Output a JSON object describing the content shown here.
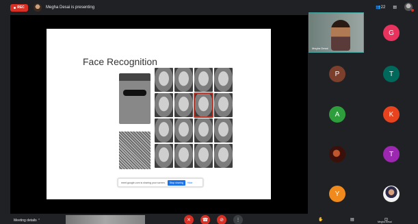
{
  "top": {
    "rec_label": "REC",
    "presenting_text": "Megha Desai is presenting",
    "participants_count": "22"
  },
  "slide": {
    "title": "Face Recognition"
  },
  "share_bar": {
    "message": "meet.google.com is sharing your screen.",
    "stop_label": "Stop sharing",
    "hide_label": "Hide"
  },
  "self_tile": {
    "name": "Megha Desai"
  },
  "participants": [
    {
      "initial": "G",
      "color": "#e8335f"
    },
    {
      "initial": "P",
      "color": "#7b3f2c"
    },
    {
      "initial": "T",
      "color": "#00695c"
    },
    {
      "initial": "A",
      "color": "#2e9e3d"
    },
    {
      "initial": "K",
      "color": "#e8431f"
    },
    {
      "initial": "",
      "color": "#5a1a14"
    },
    {
      "initial": "T",
      "color": "#9c27b0"
    },
    {
      "initial": "Y",
      "color": "#f08a1c"
    },
    {
      "initial": "",
      "color": "#f2f2f2"
    }
  ],
  "bottom": {
    "meeting_details_label": "Meeting details",
    "present_label": "Megha Desai"
  },
  "icons": [
    "record-dot-icon",
    "people-icon",
    "chat-icon",
    "raise-hand-icon",
    "captions-icon",
    "present-icon",
    "mic-off-icon",
    "camera-off-icon",
    "hangup-icon",
    "more-icon",
    "chevron-up-icon"
  ]
}
